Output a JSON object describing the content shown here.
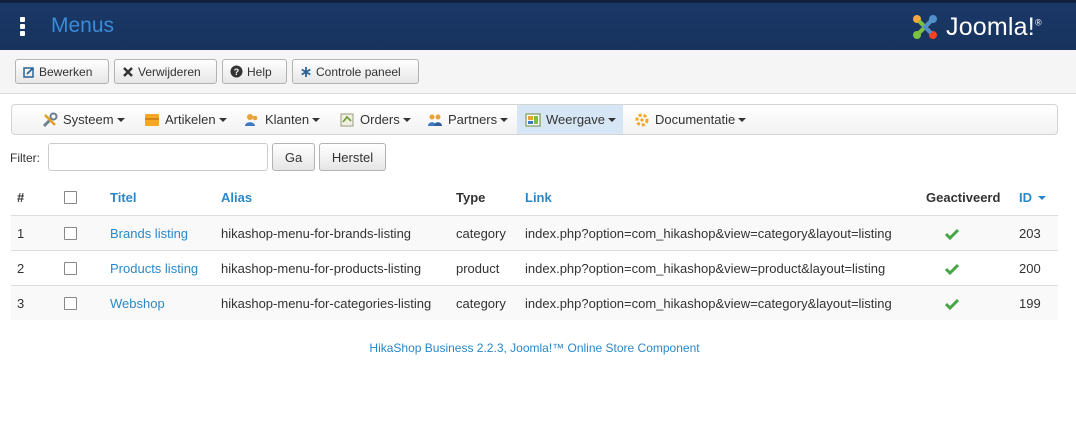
{
  "header": {
    "title": "Menus",
    "logo_text": "Joomla!",
    "logo_mark": "®"
  },
  "toolbar": {
    "edit_label": "Bewerken",
    "delete_label": "Verwijderen",
    "help_label": "Help",
    "control_panel_label": "Controle paneel"
  },
  "subnav": {
    "items": [
      {
        "label": "Systeem",
        "icon": "tools-icon"
      },
      {
        "label": "Artikelen",
        "icon": "box-icon"
      },
      {
        "label": "Klanten",
        "icon": "users-icon"
      },
      {
        "label": "Orders",
        "icon": "orders-icon"
      },
      {
        "label": "Partners",
        "icon": "partners-icon"
      },
      {
        "label": "Weergave",
        "icon": "display-icon",
        "active": true
      },
      {
        "label": "Documentatie",
        "icon": "docs-icon"
      }
    ]
  },
  "filter": {
    "label": "Filter:",
    "value": "",
    "go_label": "Ga",
    "reset_label": "Herstel"
  },
  "table": {
    "headers": {
      "num": "#",
      "title": "Titel",
      "alias": "Alias",
      "type": "Type",
      "link": "Link",
      "activated": "Geactiveerd",
      "id": "ID"
    },
    "rows": [
      {
        "num": "1",
        "title": "Brands listing",
        "alias": "hikashop-menu-for-brands-listing",
        "type": "category",
        "link": "index.php?option=com_hikashop&view=category&layout=listing",
        "activated": true,
        "id": "203"
      },
      {
        "num": "2",
        "title": "Products listing",
        "alias": "hikashop-menu-for-products-listing",
        "type": "product",
        "link": "index.php?option=com_hikashop&view=product&layout=listing",
        "activated": true,
        "id": "200"
      },
      {
        "num": "3",
        "title": "Webshop",
        "alias": "hikashop-menu-for-categories-listing",
        "type": "category",
        "link": "index.php?option=com_hikashop&view=category&layout=listing",
        "activated": true,
        "id": "199"
      }
    ]
  },
  "footer": {
    "text": "HikaShop Business 2.2.3, Joomla!™ Online Store Component"
  },
  "colors": {
    "header_bg": "#17335d",
    "title_blue": "#3a8bd8",
    "link_blue": "#2a88c9",
    "check_green": "#46a546"
  }
}
